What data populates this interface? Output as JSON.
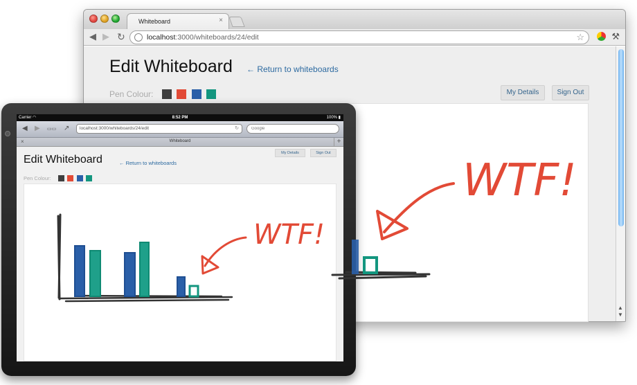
{
  "desktop": {
    "tab_title": "Whiteboard",
    "url_host": "localhost",
    "url_path": ":3000/whiteboards/24/edit",
    "page": {
      "my_details": "My Details",
      "sign_out": "Sign Out",
      "title": "Edit Whiteboard",
      "return_link": "← Return to whiteboards",
      "pen_colour_label": "Pen Colour:",
      "pen_colours": [
        "#3f3f3f",
        "#e24a36",
        "#2a5fa8",
        "#13967f"
      ],
      "drawing_text": "WTF!"
    }
  },
  "tablet": {
    "carrier": "Carrier ◠",
    "time": "8:52 PM",
    "battery": "100% ▮",
    "url": "localhost:3000/whiteboards/24/edit",
    "search_placeholder": "Google",
    "tab_title": "Whiteboard",
    "page": {
      "my_details": "My Details",
      "sign_out": "Sign Out",
      "title": "Edit Whiteboard",
      "return_link": "← Return to whiteboards",
      "pen_colour_label": "Pen Colour:",
      "pen_colours": [
        "#3f3f3f",
        "#e24a36",
        "#2a5fa8",
        "#13967f"
      ],
      "drawing_text": "WTF!"
    }
  },
  "icons": {
    "back": "◀",
    "forward": "▶",
    "reload": "↻",
    "bookmarks": "▭▭",
    "share": "↗",
    "star": "☆",
    "wrench": "⚒",
    "close": "×",
    "plus": "+"
  }
}
